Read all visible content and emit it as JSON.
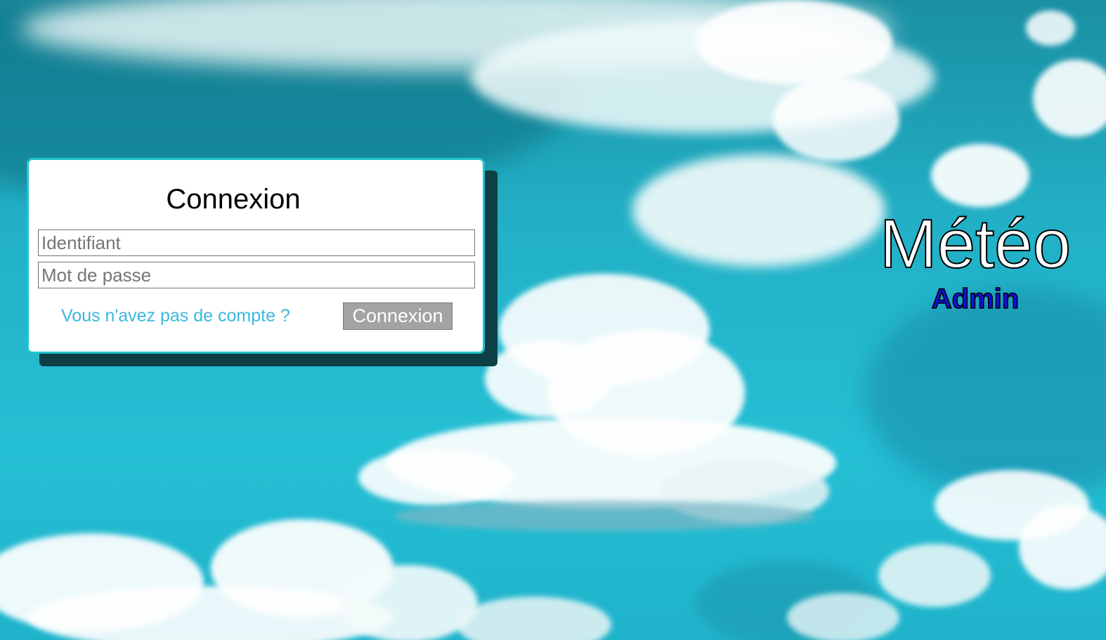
{
  "login": {
    "title": "Connexion",
    "username_placeholder": "Identifiant",
    "password_placeholder": "Mot de passe",
    "signup_link": "Vous n'avez pas de compte ?",
    "submit_label": "Connexion"
  },
  "brand": {
    "title": "Météo",
    "subtitle": "Admin"
  },
  "colors": {
    "sky": "#22b0c6",
    "card_border": "#22c4cf",
    "card_shadow": "#0d3f44",
    "link": "#3ab8e0",
    "button": "#a3a3a3",
    "subtitle": "#1212d8"
  }
}
